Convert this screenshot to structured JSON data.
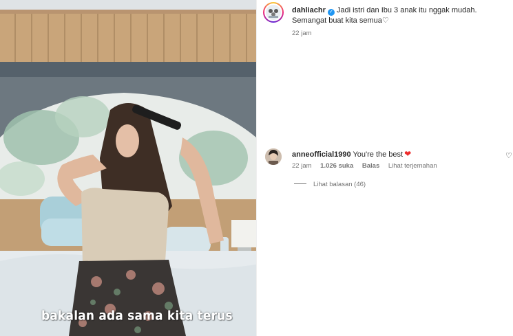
{
  "media": {
    "caption_overlay": "bakalan ada sama kita terus"
  },
  "post": {
    "username": "dahliachr",
    "caption": "Jadi istri dan Ibu 3 anak itu nggak mudah. Semangat buat kita semua",
    "caption_heart": "♡",
    "time": "22 jam"
  },
  "comment": {
    "username": "anneofficial1990",
    "text": "You're the best",
    "time": "22 jam",
    "likes": "1.026 suka",
    "reply_label": "Balas",
    "translate_label": "Lihat terjemahan",
    "view_replies": "Lihat balasan (46)"
  },
  "colors": {
    "verified": "#1f96f3",
    "heart_red": "#ed2b2b",
    "meta_gray": "#737373"
  }
}
